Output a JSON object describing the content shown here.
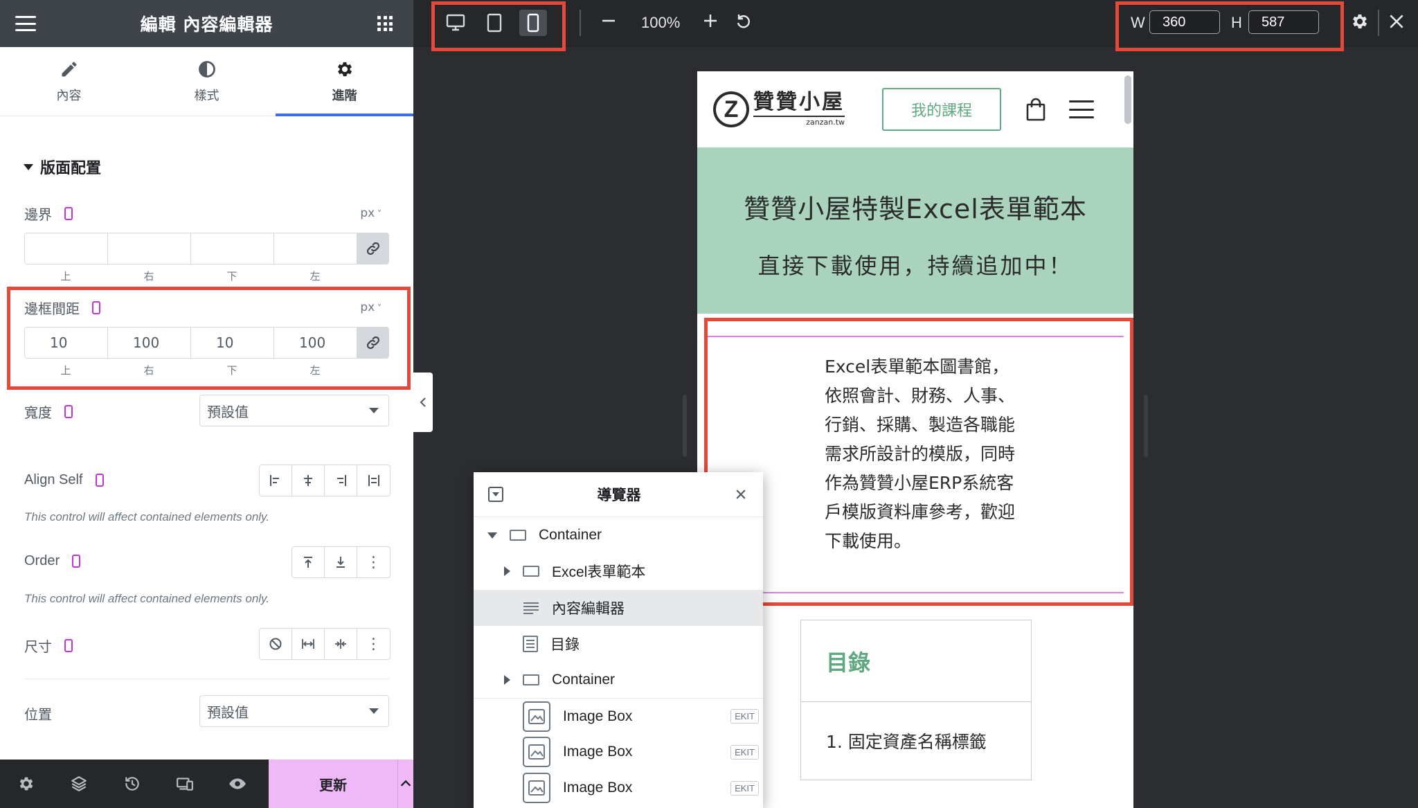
{
  "panel": {
    "title": "編輯 內容編輯器",
    "tabs": [
      {
        "label": "內容",
        "icon": "pencil-icon"
      },
      {
        "label": "樣式",
        "icon": "half-circle-icon"
      },
      {
        "label": "進階",
        "icon": "gear-icon"
      }
    ],
    "active_tab": "進階",
    "section_title": "版面配置",
    "margin": {
      "label": "邊界",
      "unit": "px",
      "values": [
        "",
        "",
        "",
        ""
      ],
      "sides": [
        "上",
        "右",
        "下",
        "左"
      ]
    },
    "padding": {
      "label": "邊框間距",
      "unit": "px",
      "values": [
        "10",
        "100",
        "10",
        "100"
      ],
      "sides": [
        "上",
        "右",
        "下",
        "左"
      ]
    },
    "width": {
      "label": "寬度",
      "value": "預設值"
    },
    "align_self": {
      "label": "Align Self",
      "note": "This control will affect contained elements only."
    },
    "order": {
      "label": "Order",
      "note": "This control will affect contained elements only."
    },
    "size": {
      "label": "尺寸"
    },
    "position": {
      "label": "位置",
      "value": "預設值"
    },
    "update_label": "更新"
  },
  "topbar": {
    "zoom": "100%",
    "width_label": "W",
    "width_value": "360",
    "height_label": "H",
    "height_value": "587"
  },
  "site": {
    "logo_text": "贊贊小屋",
    "logo_sub": "zanzan.tw",
    "course_button": "我的課程",
    "hero_title": "贊贊小屋特製Excel表單範本",
    "hero_sub": "直接下載使用，持續追加中！",
    "content_text": "Excel表單範本圖書館，依照會計、財務、人事、行銷、採購、製造各職能需求所設計的模版，同時作為贊贊小屋ERP系統客戶模版資料庫參考，歡迎下載使用。",
    "toc_title": "目錄",
    "toc_item": "1.  固定資產名稱標籤"
  },
  "navigator": {
    "title": "導覽器",
    "items": [
      {
        "label": "Container"
      },
      {
        "label": "Excel表單範本"
      },
      {
        "label": "內容編輯器"
      },
      {
        "label": "目錄"
      },
      {
        "label": "Container"
      },
      {
        "label": "Image Box",
        "badge": "EKIT"
      },
      {
        "label": "Image Box",
        "badge": "EKIT"
      },
      {
        "label": "Image Box",
        "badge": "EKIT"
      }
    ]
  },
  "colors": {
    "accent_blue": "#3c6fe1",
    "highlight_red": "#e5493a",
    "hero_green": "#a9d3bc",
    "brand_green": "#5fa882",
    "update_pink": "#efb9f7",
    "responsive_magenta": "#c036d5"
  }
}
